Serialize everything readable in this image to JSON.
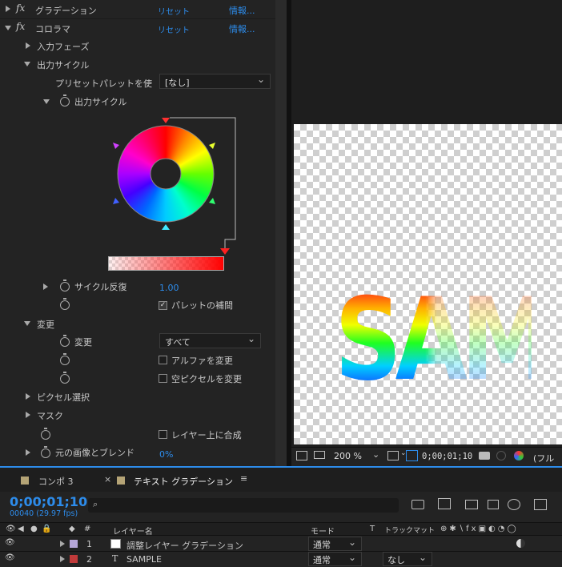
{
  "effects": {
    "gradient": {
      "name": "グラデーション",
      "reset": "リセット",
      "info": "情報..."
    },
    "colorama": {
      "name": "コロラマ",
      "reset": "リセット",
      "info": "情報..."
    }
  },
  "fx_icon": "fx",
  "colorama": {
    "input_phase": "入力フェーズ",
    "output_cycle_group": "出力サイクル",
    "preset_label": "プリセットパレットを使",
    "preset_value": "[なし]",
    "output_cycle": "出力サイクル",
    "cycle_repeat_label": "サイクル反復",
    "cycle_repeat_value": "1.00",
    "interpolate_palette": "パレットの補間",
    "modify_group": "変更",
    "modify_label": "変更",
    "modify_value": "すべて",
    "modify_alpha": "アルファを変更",
    "modify_empty_pixels": "空ピクセルを変更",
    "pixel_selection": "ピクセル選択",
    "mask": "マスク",
    "composite_over_layer": "レイヤー上に合成",
    "blend_label": "元の画像とブレンド",
    "blend_value": "0%"
  },
  "viewer": {
    "sample_text": "SAMPLE",
    "zoom": "200 %",
    "timecode": "0;00;01;10",
    "resolution": "(フル画"
  },
  "timeline": {
    "tabs": [
      {
        "label": "コンポ 3"
      },
      {
        "label": "テキスト グラデーション"
      }
    ],
    "close_glyph": "×",
    "menu_glyph": "≡",
    "timecode": "0;00;01;10",
    "frame_info": "00040 (29.97 fps)",
    "search_icon": "⌕",
    "headers": {
      "num": "#",
      "layer_name": "レイヤー名",
      "mode": "モード",
      "t": "T",
      "track_matte": "トラックマット"
    },
    "layers": [
      {
        "num": "1",
        "color": "#b5a6d8",
        "type_icon": "solid",
        "name": "調整レイヤー グラデーション",
        "mode": "通常",
        "matte": ""
      },
      {
        "num": "2",
        "color": "#c03a3a",
        "type_icon": "T",
        "name": "SAMPLE",
        "mode": "通常",
        "matte": "なし"
      }
    ]
  },
  "colors": {
    "accent": "#2d8ceb",
    "panel": "#232323",
    "viewer_bg": "#1e1e1e"
  }
}
